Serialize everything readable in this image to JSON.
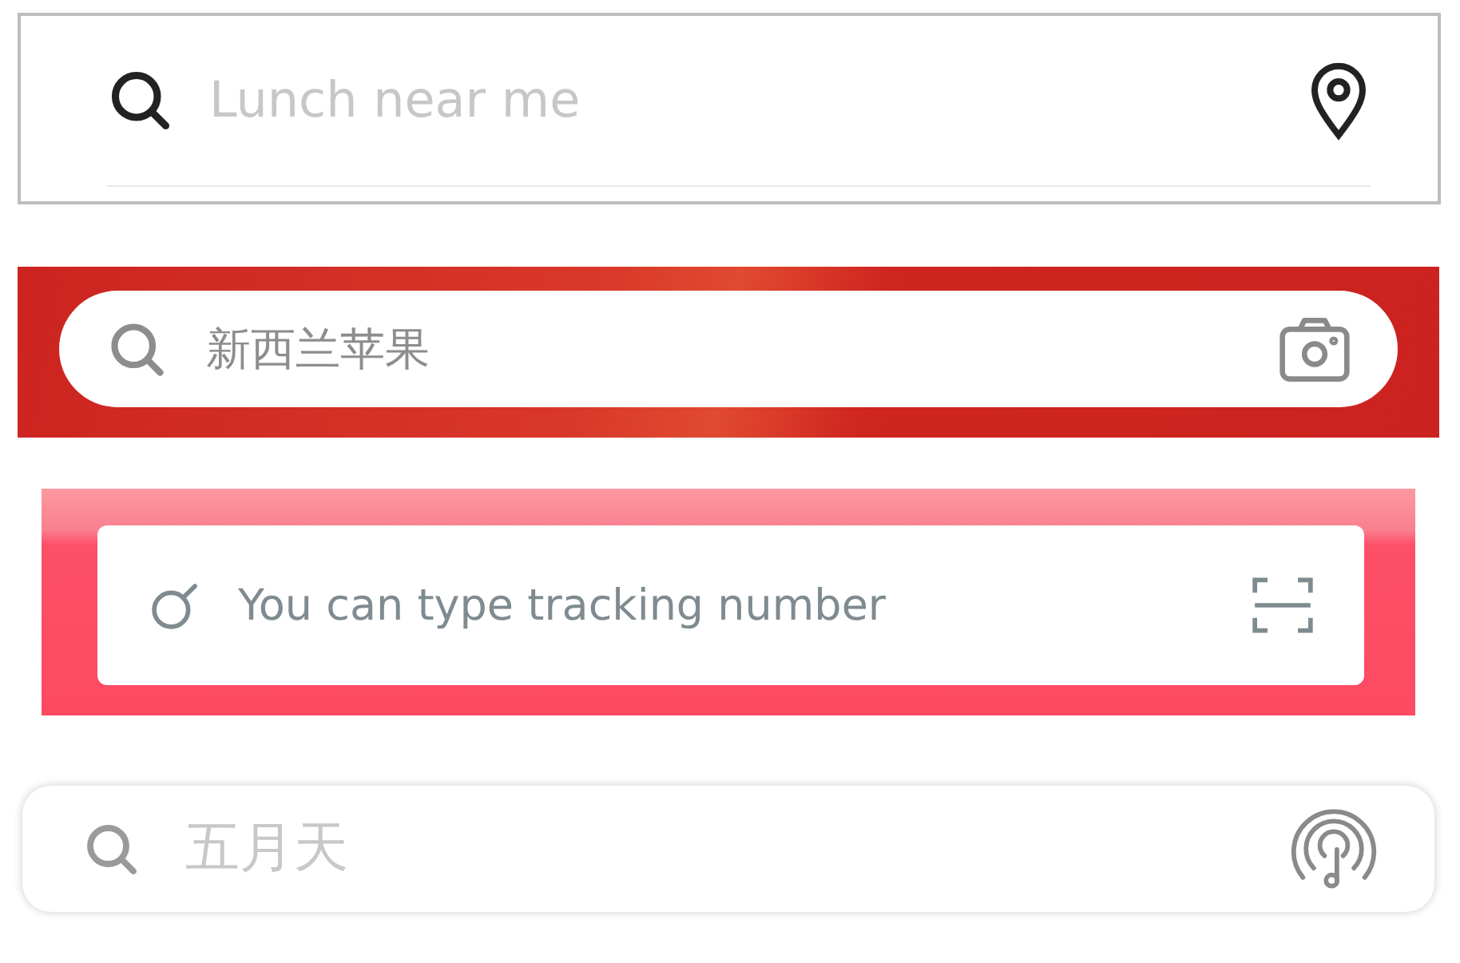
{
  "search_bars": [
    {
      "kind": "outlined",
      "placeholder": "Lunch near me"
    },
    {
      "kind": "red",
      "placeholder": "新西兰苹果"
    },
    {
      "kind": "pink",
      "placeholder": "You can type tracking number"
    },
    {
      "kind": "floating",
      "placeholder": "五月天"
    }
  ]
}
